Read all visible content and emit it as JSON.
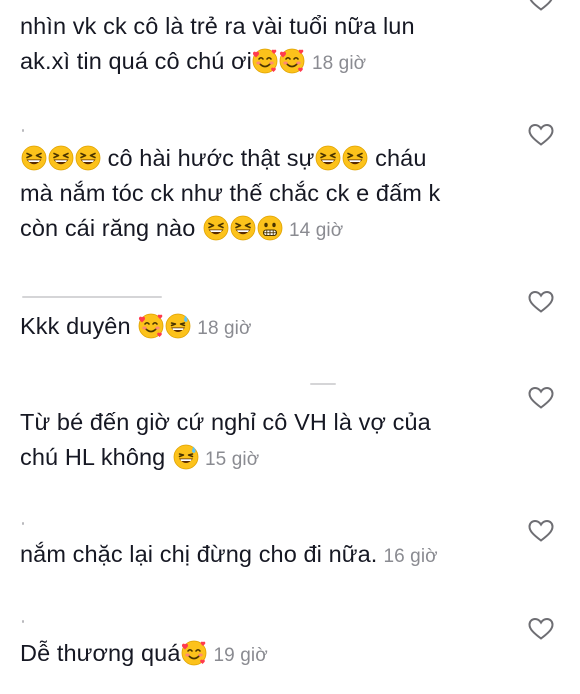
{
  "comments": [
    {
      "lines": [
        "nhìn vk ck cô là trẻ ra vài tuổi nữa lun",
        "ak.xì tin quá cô chú ơi"
      ],
      "emojis": [
        "smiling-face-with-hearts-emoji",
        "smiling-face-with-hearts-emoji"
      ],
      "time": "18 giờ"
    },
    {
      "line1_emojis": [
        "grinning-squinting-face-emoji",
        "grinning-squinting-face-emoji",
        "grinning-squinting-face-emoji"
      ],
      "line1_text_a": "cô hài hước thật sự",
      "line1_mid_emojis": [
        "grinning-squinting-face-emoji",
        "grinning-squinting-face-emoji"
      ],
      "line1_text_b": "cháu",
      "line2": "mà nắm tóc ck như thế chắc ck e đấm k",
      "line3": "còn cái răng nào",
      "line3_emojis": [
        "grinning-squinting-face-emoji",
        "grinning-squinting-face-emoji",
        "grimacing-face-emoji"
      ],
      "time": "14 giờ"
    },
    {
      "text": "Kkk duyên",
      "emojis": [
        "smiling-face-with-hearts-emoji",
        "grinning-face-with-sweat-emoji"
      ],
      "time": "18 giờ"
    },
    {
      "line1": "Từ bé đến giờ cứ nghỉ cô VH là vợ của",
      "line2": "chú HL không",
      "emojis": [
        "grinning-face-with-sweat-emoji"
      ],
      "time": "15 giờ"
    },
    {
      "text": "nắm chặc lại chị đừng cho đi nữa.",
      "time": "16 giờ"
    },
    {
      "text": "Dễ thương quá",
      "emojis": [
        "smiling-face-with-hearts-emoji"
      ],
      "time": "19 giờ"
    }
  ],
  "icons": {
    "like": "heart-outline-icon"
  },
  "colors": {
    "text": "#161823",
    "timestamp": "#8a8b91",
    "heart_stroke": "#6e6e73",
    "emoji_face": "#fcc21b"
  }
}
